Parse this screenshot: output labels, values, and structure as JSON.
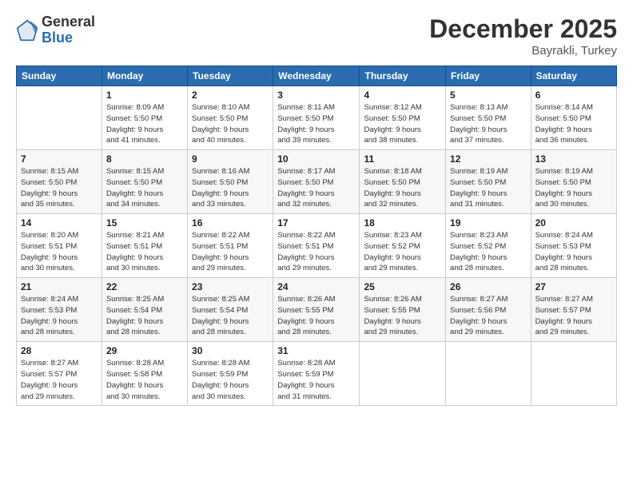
{
  "header": {
    "logo_general": "General",
    "logo_blue": "Blue",
    "month": "December 2025",
    "location": "Bayrakli, Turkey"
  },
  "days_of_week": [
    "Sunday",
    "Monday",
    "Tuesday",
    "Wednesday",
    "Thursday",
    "Friday",
    "Saturday"
  ],
  "weeks": [
    [
      {
        "num": "",
        "sunrise": "",
        "sunset": "",
        "daylight": ""
      },
      {
        "num": "1",
        "sunrise": "Sunrise: 8:09 AM",
        "sunset": "Sunset: 5:50 PM",
        "daylight": "Daylight: 9 hours and 41 minutes."
      },
      {
        "num": "2",
        "sunrise": "Sunrise: 8:10 AM",
        "sunset": "Sunset: 5:50 PM",
        "daylight": "Daylight: 9 hours and 40 minutes."
      },
      {
        "num": "3",
        "sunrise": "Sunrise: 8:11 AM",
        "sunset": "Sunset: 5:50 PM",
        "daylight": "Daylight: 9 hours and 39 minutes."
      },
      {
        "num": "4",
        "sunrise": "Sunrise: 8:12 AM",
        "sunset": "Sunset: 5:50 PM",
        "daylight": "Daylight: 9 hours and 38 minutes."
      },
      {
        "num": "5",
        "sunrise": "Sunrise: 8:13 AM",
        "sunset": "Sunset: 5:50 PM",
        "daylight": "Daylight: 9 hours and 37 minutes."
      },
      {
        "num": "6",
        "sunrise": "Sunrise: 8:14 AM",
        "sunset": "Sunset: 5:50 PM",
        "daylight": "Daylight: 9 hours and 36 minutes."
      }
    ],
    [
      {
        "num": "7",
        "sunrise": "Sunrise: 8:15 AM",
        "sunset": "Sunset: 5:50 PM",
        "daylight": "Daylight: 9 hours and 35 minutes."
      },
      {
        "num": "8",
        "sunrise": "Sunrise: 8:15 AM",
        "sunset": "Sunset: 5:50 PM",
        "daylight": "Daylight: 9 hours and 34 minutes."
      },
      {
        "num": "9",
        "sunrise": "Sunrise: 8:16 AM",
        "sunset": "Sunset: 5:50 PM",
        "daylight": "Daylight: 9 hours and 33 minutes."
      },
      {
        "num": "10",
        "sunrise": "Sunrise: 8:17 AM",
        "sunset": "Sunset: 5:50 PM",
        "daylight": "Daylight: 9 hours and 32 minutes."
      },
      {
        "num": "11",
        "sunrise": "Sunrise: 8:18 AM",
        "sunset": "Sunset: 5:50 PM",
        "daylight": "Daylight: 9 hours and 32 minutes."
      },
      {
        "num": "12",
        "sunrise": "Sunrise: 8:19 AM",
        "sunset": "Sunset: 5:50 PM",
        "daylight": "Daylight: 9 hours and 31 minutes."
      },
      {
        "num": "13",
        "sunrise": "Sunrise: 8:19 AM",
        "sunset": "Sunset: 5:50 PM",
        "daylight": "Daylight: 9 hours and 30 minutes."
      }
    ],
    [
      {
        "num": "14",
        "sunrise": "Sunrise: 8:20 AM",
        "sunset": "Sunset: 5:51 PM",
        "daylight": "Daylight: 9 hours and 30 minutes."
      },
      {
        "num": "15",
        "sunrise": "Sunrise: 8:21 AM",
        "sunset": "Sunset: 5:51 PM",
        "daylight": "Daylight: 9 hours and 30 minutes."
      },
      {
        "num": "16",
        "sunrise": "Sunrise: 8:22 AM",
        "sunset": "Sunset: 5:51 PM",
        "daylight": "Daylight: 9 hours and 29 minutes."
      },
      {
        "num": "17",
        "sunrise": "Sunrise: 8:22 AM",
        "sunset": "Sunset: 5:51 PM",
        "daylight": "Daylight: 9 hours and 29 minutes."
      },
      {
        "num": "18",
        "sunrise": "Sunrise: 8:23 AM",
        "sunset": "Sunset: 5:52 PM",
        "daylight": "Daylight: 9 hours and 29 minutes."
      },
      {
        "num": "19",
        "sunrise": "Sunrise: 8:23 AM",
        "sunset": "Sunset: 5:52 PM",
        "daylight": "Daylight: 9 hours and 28 minutes."
      },
      {
        "num": "20",
        "sunrise": "Sunrise: 8:24 AM",
        "sunset": "Sunset: 5:53 PM",
        "daylight": "Daylight: 9 hours and 28 minutes."
      }
    ],
    [
      {
        "num": "21",
        "sunrise": "Sunrise: 8:24 AM",
        "sunset": "Sunset: 5:53 PM",
        "daylight": "Daylight: 9 hours and 28 minutes."
      },
      {
        "num": "22",
        "sunrise": "Sunrise: 8:25 AM",
        "sunset": "Sunset: 5:54 PM",
        "daylight": "Daylight: 9 hours and 28 minutes."
      },
      {
        "num": "23",
        "sunrise": "Sunrise: 8:25 AM",
        "sunset": "Sunset: 5:54 PM",
        "daylight": "Daylight: 9 hours and 28 minutes."
      },
      {
        "num": "24",
        "sunrise": "Sunrise: 8:26 AM",
        "sunset": "Sunset: 5:55 PM",
        "daylight": "Daylight: 9 hours and 28 minutes."
      },
      {
        "num": "25",
        "sunrise": "Sunrise: 8:26 AM",
        "sunset": "Sunset: 5:55 PM",
        "daylight": "Daylight: 9 hours and 29 minutes."
      },
      {
        "num": "26",
        "sunrise": "Sunrise: 8:27 AM",
        "sunset": "Sunset: 5:56 PM",
        "daylight": "Daylight: 9 hours and 29 minutes."
      },
      {
        "num": "27",
        "sunrise": "Sunrise: 8:27 AM",
        "sunset": "Sunset: 5:57 PM",
        "daylight": "Daylight: 9 hours and 29 minutes."
      }
    ],
    [
      {
        "num": "28",
        "sunrise": "Sunrise: 8:27 AM",
        "sunset": "Sunset: 5:57 PM",
        "daylight": "Daylight: 9 hours and 29 minutes."
      },
      {
        "num": "29",
        "sunrise": "Sunrise: 8:28 AM",
        "sunset": "Sunset: 5:58 PM",
        "daylight": "Daylight: 9 hours and 30 minutes."
      },
      {
        "num": "30",
        "sunrise": "Sunrise: 8:28 AM",
        "sunset": "Sunset: 5:59 PM",
        "daylight": "Daylight: 9 hours and 30 minutes."
      },
      {
        "num": "31",
        "sunrise": "Sunrise: 8:28 AM",
        "sunset": "Sunset: 5:59 PM",
        "daylight": "Daylight: 9 hours and 31 minutes."
      },
      {
        "num": "",
        "sunrise": "",
        "sunset": "",
        "daylight": ""
      },
      {
        "num": "",
        "sunrise": "",
        "sunset": "",
        "daylight": ""
      },
      {
        "num": "",
        "sunrise": "",
        "sunset": "",
        "daylight": ""
      }
    ]
  ]
}
